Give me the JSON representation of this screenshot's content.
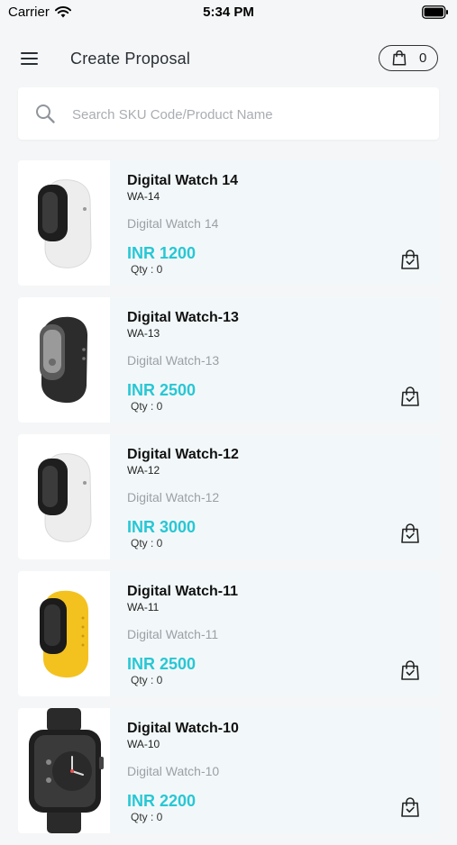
{
  "status": {
    "carrier": "Carrier",
    "time": "5:34 PM"
  },
  "header": {
    "title": "Create Proposal",
    "cart_count": "0"
  },
  "search": {
    "placeholder": "Search SKU Code/Product Name"
  },
  "products": [
    {
      "name": "Digital Watch 14",
      "sku": "WA-14",
      "desc": "Digital Watch 14",
      "price": "INR 1200",
      "qty": "Qty : 0",
      "band": "white-band"
    },
    {
      "name": "Digital Watch-13",
      "sku": "WA-13",
      "desc": "Digital Watch-13",
      "price": "INR 2500",
      "qty": "Qty : 0",
      "band": "black-band"
    },
    {
      "name": "Digital Watch-12",
      "sku": "WA-12",
      "desc": "Digital Watch-12",
      "price": "INR 3000",
      "qty": "Qty : 0",
      "band": "white-band"
    },
    {
      "name": "Digital Watch-11",
      "sku": "WA-11",
      "desc": "Digital Watch-11",
      "price": "INR 2500",
      "qty": "Qty : 0",
      "band": "yellow-band"
    },
    {
      "name": "Digital Watch-10",
      "sku": "WA-10",
      "desc": "Digital Watch-10",
      "price": "INR 2200",
      "qty": "Qty : 0",
      "band": "smartwatch"
    }
  ],
  "colors": {
    "accent": "#27c7d5",
    "card_bg": "#f2f8f9",
    "page_bg": "#f5f6f7"
  }
}
